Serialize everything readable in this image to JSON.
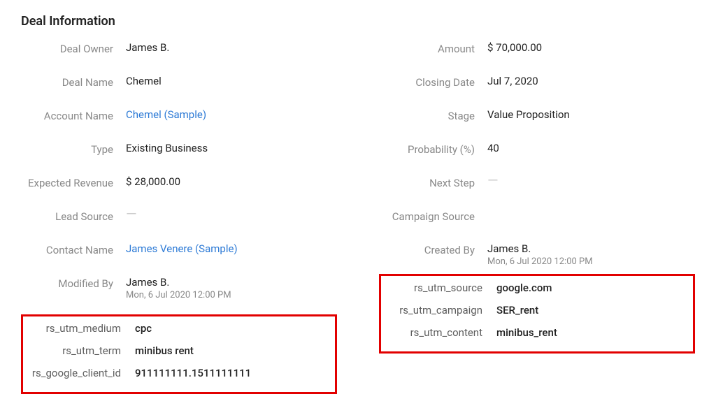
{
  "section_title": "Deal Information",
  "left": {
    "deal_owner": {
      "label": "Deal Owner",
      "value": "James B."
    },
    "deal_name": {
      "label": "Deal Name",
      "value": "Chemel"
    },
    "account_name": {
      "label": "Account Name",
      "value": "Chemel (Sample)"
    },
    "type": {
      "label": "Type",
      "value": "Existing Business"
    },
    "expected_revenue": {
      "label": "Expected Revenue",
      "value": "$ 28,000.00"
    },
    "lead_source": {
      "label": "Lead Source",
      "value": "—"
    },
    "contact_name": {
      "label": "Contact Name",
      "value": "James Venere (Sample)"
    },
    "modified_by": {
      "label": "Modified By",
      "value": "James B.",
      "sub": "Mon, 6 Jul 2020 12:00 PM"
    }
  },
  "right": {
    "amount": {
      "label": "Amount",
      "value": "$ 70,000.00"
    },
    "closing_date": {
      "label": "Closing Date",
      "value": "Jul 7, 2020"
    },
    "stage": {
      "label": "Stage",
      "value": "Value Proposition"
    },
    "probability": {
      "label": "Probability (%)",
      "value": "40"
    },
    "next_step": {
      "label": "Next Step",
      "value": "—"
    },
    "campaign_source": {
      "label": "Campaign Source",
      "value": ""
    },
    "created_by": {
      "label": "Created By",
      "value": "James B.",
      "sub": "Mon, 6 Jul 2020 12:00 PM"
    }
  },
  "utm_left": {
    "medium": {
      "label": "rs_utm_medium",
      "value": "cpc"
    },
    "term": {
      "label": "rs_utm_term",
      "value": "minibus rent"
    },
    "google_client_id": {
      "label": "rs_google_client_id",
      "value": "911111111.1511111111"
    }
  },
  "utm_right": {
    "source": {
      "label": "rs_utm_source",
      "value": "google.com"
    },
    "campaign": {
      "label": "rs_utm_campaign",
      "value": "SER_rent"
    },
    "content": {
      "label": "rs_utm_content",
      "value": "minibus_rent"
    }
  }
}
